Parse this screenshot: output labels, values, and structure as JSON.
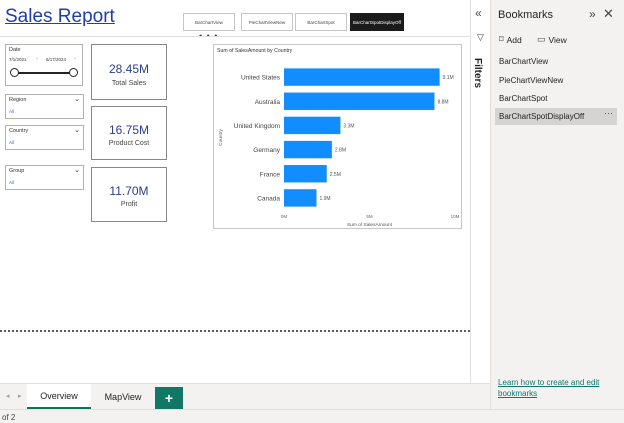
{
  "report": {
    "title": "Sales Report",
    "nav_buttons": [
      "BarChartView",
      "PieChartViewNew",
      "BarChartSpot",
      "BarChartSpotDisplayOff"
    ],
    "more_dots": "• • •"
  },
  "slicers": {
    "date": {
      "title": "Date",
      "from": "7/1/2021",
      "to": "6/17/2024"
    },
    "region": {
      "title": "Region",
      "value": "All"
    },
    "country": {
      "title": "Country",
      "value": "All"
    },
    "group": {
      "title": "Group",
      "value": "All"
    }
  },
  "cards": [
    {
      "value": "28.45M",
      "label": "Total Sales"
    },
    {
      "value": "16.75M",
      "label": "Product Cost"
    },
    {
      "value": "11.70M",
      "label": "Profit"
    }
  ],
  "chart_data": {
    "type": "bar",
    "orientation": "horizontal",
    "title": "Sum of SalesAmount by Country",
    "xlabel": "Sum of SalesAmount",
    "ylabel": "Country",
    "categories": [
      "United States",
      "Australia",
      "United Kingdom",
      "Germany",
      "France",
      "Canada"
    ],
    "values": [
      9.1,
      8.8,
      3.3,
      2.8,
      2.5,
      1.9
    ],
    "data_labels": [
      "9.1M",
      "8.8M",
      "3.3M",
      "2.8M",
      "2.5M",
      "1.9M"
    ],
    "xlim": [
      0,
      10
    ],
    "xticks": [
      0,
      5,
      10
    ],
    "xtick_labels": [
      "0M",
      "5M",
      "10M"
    ],
    "bar_color": "#118dff",
    "grid": false
  },
  "tabs": {
    "pages": [
      "Overview",
      "MapView"
    ],
    "add": "+"
  },
  "status": {
    "page_info": "of 2"
  },
  "filters_pane": {
    "label": "Filters"
  },
  "bookmarks": {
    "title": "Bookmarks",
    "add_label": "Add",
    "view_label": "View",
    "items": [
      "BarChartView",
      "PieChartViewNew",
      "BarChartSpot",
      "BarChartSpotDisplayOff"
    ],
    "selected_index": 3,
    "learn_link": "Learn how to create and edit bookmarks"
  },
  "icons": {
    "collapse": "«",
    "expand": "»",
    "close": "✕",
    "filter": "▽",
    "add": "⌑",
    "view": "▭",
    "more": "⋯",
    "chevron": "⌄",
    "prev": "◂",
    "next": "▸"
  }
}
